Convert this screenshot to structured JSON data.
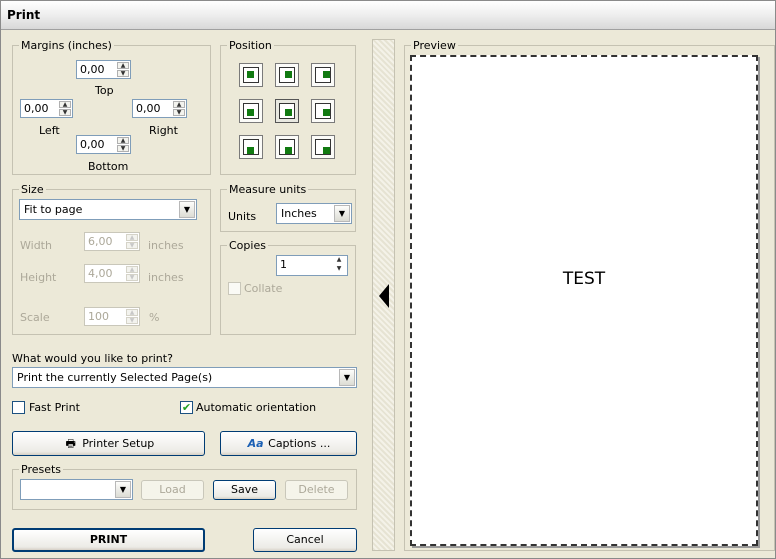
{
  "window": {
    "title": "Print"
  },
  "margins": {
    "legend": "Margins (inches)",
    "top": {
      "value": "0,00",
      "label": "Top"
    },
    "left": {
      "value": "0,00",
      "label": "Left"
    },
    "right": {
      "value": "0,00",
      "label": "Right"
    },
    "bottom": {
      "value": "0,00",
      "label": "Bottom"
    }
  },
  "position": {
    "legend": "Position",
    "selected": "middle-center"
  },
  "size": {
    "legend": "Size",
    "mode": "Fit to page",
    "width_label": "Width",
    "width_value": "6,00",
    "width_unit": "inches",
    "height_label": "Height",
    "height_value": "4,00",
    "height_unit": "inches",
    "scale_label": "Scale",
    "scale_value": "100",
    "scale_unit": "%"
  },
  "measure": {
    "legend": "Measure units",
    "units_label": "Units",
    "units_value": "Inches"
  },
  "copies": {
    "legend": "Copies",
    "value": "1",
    "collate_label": "Collate"
  },
  "what": {
    "question": "What would you like to print?",
    "value": "Print the currently Selected Page(s)"
  },
  "options": {
    "fast_print": "Fast Print",
    "auto_orientation": "Automatic orientation",
    "fast_checked": false,
    "auto_checked": true
  },
  "buttons": {
    "printer_setup": "Printer Setup",
    "captions": "Captions ...",
    "print": "PRINT",
    "cancel": "Cancel"
  },
  "presets": {
    "legend": "Presets",
    "value": "",
    "load": "Load",
    "save": "Save",
    "delete": "Delete"
  },
  "preview": {
    "legend": "Preview",
    "page_text": "TEST"
  },
  "colors": {
    "accent_green": "#117a11",
    "check_green": "#21a121",
    "border_blue": "#003c74"
  }
}
